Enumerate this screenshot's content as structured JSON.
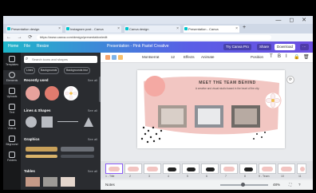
{
  "browser": {
    "window_controls": "— ◻ ✕",
    "tabs": [
      {
        "label": "Presentation design"
      },
      {
        "label": "Instagram post - Canva"
      },
      {
        "label": "Canva design"
      },
      {
        "label": "Presentation - Canva"
      }
    ],
    "url": "https://www.canva.com/design/presentation/edit"
  },
  "canva_top": {
    "home": "Home",
    "file": "File",
    "resize": "Resize",
    "doc_title": "Presentation - Pink Pastel Creative",
    "upgrade": "Try Canva Pro",
    "share": "Share",
    "download": "Download",
    "publish": "Publish"
  },
  "rail": [
    {
      "label": "Templates"
    },
    {
      "label": "Elements"
    },
    {
      "label": "Uploads"
    },
    {
      "label": "Text"
    },
    {
      "label": "Videos"
    },
    {
      "label": "Bkground"
    },
    {
      "label": "Folders"
    }
  ],
  "panel": {
    "search_placeholder": "Search icons and shapes",
    "chips": [
      "Lines",
      "Backgrounds",
      "Backgrounds blur"
    ],
    "sections": [
      {
        "title": "Recently used",
        "see_all": "See all"
      },
      {
        "title": "Lines & Shapes",
        "see_all": "See all"
      },
      {
        "title": "Graphics",
        "see_all": "See all"
      },
      {
        "title": "Tables",
        "see_all": "See all"
      }
    ]
  },
  "toolbar": {
    "colors": [
      "#f4a36c",
      "#7fb4e8",
      "#f6c06d"
    ],
    "font": "Montserrat",
    "size": "12",
    "effects": "Effects",
    "animate": "Animate",
    "position": "Position"
  },
  "slide": {
    "title": "MEET THE TEAM BEHIND",
    "subtitle": "A creative and visual studio based in the heart of the city."
  },
  "pages": [
    {
      "label": "1 - Title"
    },
    {
      "label": "2"
    },
    {
      "label": "3"
    },
    {
      "label": "4"
    },
    {
      "label": "5"
    },
    {
      "label": "6"
    },
    {
      "label": "7"
    },
    {
      "label": "8"
    },
    {
      "label": "9 - Team"
    },
    {
      "label": "10"
    },
    {
      "label": "11"
    }
  ],
  "statusbar": {
    "notes": "Notes",
    "zoom": "48%"
  }
}
